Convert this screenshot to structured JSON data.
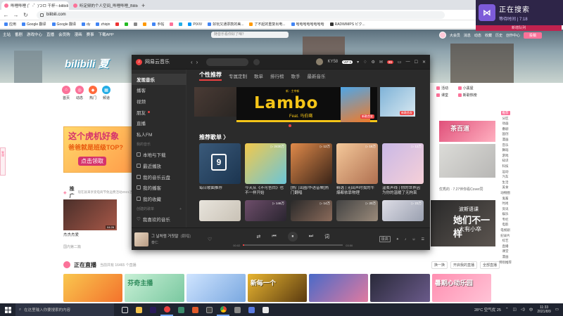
{
  "browser": {
    "tabs": [
      {
        "label": "哔哩哔哩 (゜-゜)つロ 干杯~-bilibili",
        "active": true
      },
      {
        "label": "听定频的个人空间_哔哩哔哩_Bilibili",
        "active": false
      }
    ],
    "new_tab": "+",
    "url": "bilibili.com",
    "bookmarks": [
      "应用",
      "Google 翻译",
      "Google 翻译",
      "dy",
      "zhiqin",
      "",
      "",
      "",
      "",
      "手帖",
      "",
      "",
      "PIXIV",
      "好玩又通票款的美...",
      "",
      "了不起的重复出电...",
      "哈哈哈哈哈哈哈哈",
      "RADWIMPS ピク..."
    ]
  },
  "overlay": {
    "title": "正在搜索",
    "subtitle": "等待时间 | 7:18",
    "strip": "新增队列"
  },
  "bili": {
    "nav": [
      "主站",
      "番剧",
      "游戏中心",
      "直播",
      "会员购",
      "漫画",
      "赛事",
      "",
      "下载APP"
    ],
    "search_placeholder": "随音乐看你好了咱？",
    "right": [
      "大会员",
      "消息",
      "动态",
      "收藏",
      "历史",
      "创作中心"
    ],
    "upload": "投稿",
    "logo": "bilibili 夏",
    "channels": [
      {
        "label": "首页",
        "color": "#fb7299",
        "glyph": "⌂"
      },
      {
        "label": "动态",
        "color": "#fb7299",
        "glyph": "◎"
      },
      {
        "label": "热门",
        "color": "#ff6a3d",
        "glyph": "◆"
      },
      {
        "label": "频道",
        "color": "#23ade5",
        "glyph": "▦"
      }
    ],
    "right_grid": [
      "活动",
      "小黑屋",
      "课堂",
      "新歌热榜",
      "",
      ""
    ],
    "banner": {
      "l1": "这个虎机好象",
      "l2": "爸爸就是班级TOP?",
      "l3": "点击领取"
    },
    "promo": {
      "title": "推广",
      "sub": "现在就来享受电商节免运费活动2021活",
      "caption": "杰杰杰爱",
      "caption2": "国内第二篇",
      "badge": "04:26"
    },
    "right_ad": {
      "l1": "茶百道",
      "cap": "优秀的 · 7.27伴你看Cover同",
      "cap2": "",
      "ad3": {
        "a": "波斯语课",
        "b": "她们不一样",
        "c": "大有小卒"
      }
    },
    "side_nav": [
      "推荐",
      "分区",
      "动画",
      "番剧",
      "国创",
      "漫画",
      "音乐",
      "舞蹈",
      "游戏",
      "知识",
      "科技",
      "运动",
      "汽车",
      "生活",
      "美食",
      "动物圈",
      "鬼畜",
      "时尚",
      "资讯",
      "娱乐",
      "专栏",
      "电影",
      "电视剧",
      "纪录片",
      "综艺",
      "直播",
      "课堂",
      "漫画",
      "特别推荐"
    ],
    "live": {
      "title": "正在直播",
      "sub": "当前共有 16465 个直播",
      "r1": "换一换",
      "r2": "开启我的直播",
      "r3": "全部直播"
    },
    "live_cards": [
      "",
      "芬奇主播",
      "",
      "新每一个",
      "",
      "",
      "暑期心动乐园"
    ]
  },
  "music": {
    "app_title": "网易云音乐",
    "user": "KY58",
    "vip": "VIP 5",
    "mail_badge": "99",
    "sidebar": {
      "items": [
        "发现音乐",
        "播客",
        "视频",
        "朋友",
        "直播",
        "私人FM"
      ],
      "my_music_header": "我的音乐",
      "my_items": [
        "本地与下载",
        "最近播放",
        "我的音乐云盘",
        "我的播客",
        "我的收藏"
      ],
      "created_header": "创建的歌单",
      "created_items": [
        "我喜欢的音乐"
      ]
    },
    "tabs": [
      "个性推荐",
      "专属定制",
      "歌单",
      "排行榜",
      "歌手",
      "最新音乐"
    ],
    "banner": {
      "lambo": "Lambo",
      "feat": "Feat. 马伯骞",
      "small": "新 · 主宰新",
      "tag": "新歌首发",
      "tag2": "新歌首发"
    },
    "section_title": "推荐歌单 〉",
    "cards": [
      {
        "name": "每日歌曲推荐",
        "count": "",
        "colors": [
          "#3a5a7a",
          "#1c3550"
        ],
        "calendar": "9"
      },
      {
        "name": "今天从《不可告白》也不一样开始",
        "count": "▷ 2430万",
        "colors": [
          "#f2c94c",
          "#6bc5d8"
        ]
      },
      {
        "name": "[热门出圈/华语音樂]热门翻唱",
        "count": "▷ 12万",
        "colors": [
          "#e08a4a",
          "#3a2418"
        ]
      },
      {
        "name": "精选 | 无回声时我的牛爆都依靠物理",
        "count": "▷ 16万",
        "colors": [
          "#f4c89a",
          "#b07050"
        ]
      },
      {
        "name": "温柔声线 | 你的世界因为你的温暖了无拘束",
        "count": "▷ 12万",
        "colors": [
          "#c9b8e6",
          "#f6d0d8"
        ]
      }
    ],
    "cards2": [
      {
        "count": "",
        "colors": [
          "#e8e4dc",
          "#c9c2b6"
        ]
      },
      {
        "count": "▷ 146万",
        "colors": [
          "#6d4d6a",
          "#2a2530"
        ]
      },
      {
        "count": "▷ 14万",
        "colors": [
          "#2a2a2a",
          "#8a6a5a"
        ]
      },
      {
        "count": "▷ 20万",
        "colors": [
          "#444",
          "#9a8a7a"
        ]
      },
      {
        "count": "▷ 23万",
        "colors": [
          "#dddde6",
          "#9aa0b0"
        ]
      }
    ],
    "player": {
      "song": "그 날처럼 거짓말",
      "tag": "(翻唱)",
      "artist": "泰仁",
      "time_cur": "00:02",
      "time_total": "03:50",
      "progress": 0.01,
      "quality": "极高",
      "buttons": {
        "mode": "⇄",
        "prev": "⏮",
        "play": "⏸",
        "next": "⏭",
        "lyric": "词"
      }
    }
  },
  "taskbar": {
    "search": "在这里输入你要搜索的内容",
    "weather": "28°C 空气优 25",
    "time": "11:33",
    "date": "2021/8/9",
    "lang": "中"
  }
}
